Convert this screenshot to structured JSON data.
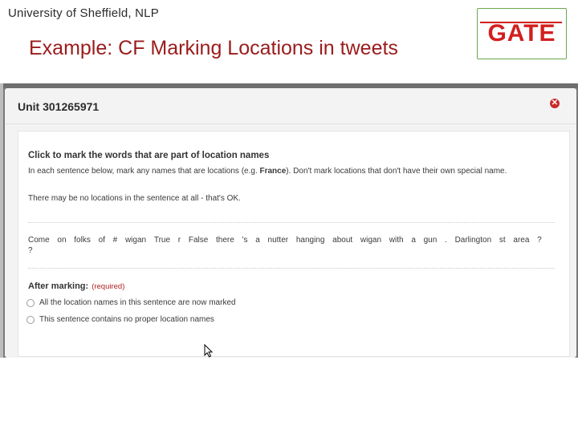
{
  "slide": {
    "organization": "University of Sheffield, NLP",
    "title": "Example: CF Marking Locations in tweets",
    "logo_text": "GATE",
    "brand_color": "#d21f1f",
    "title_color": "#9b1b1b"
  },
  "modal": {
    "title": "Unit 301265971",
    "close_icon": "close-icon"
  },
  "task": {
    "heading": "Click to mark the words that are part of location names",
    "instruction_pre": "In each sentence below, mark any names that are locations (e.g. ",
    "instruction_bold": "France",
    "instruction_post": "). Don't mark locations that don't have their own special name.",
    "note": "There may be no locations in the sentence at all - that's OK.",
    "tweet_tokens": [
      "Come",
      "on",
      "folks",
      "of",
      "#",
      "wigan",
      "True",
      "r",
      "False",
      "there",
      "'s",
      "a",
      "nutter",
      "hanging",
      "about",
      "wigan",
      "with",
      "a",
      "gun",
      ".",
      "Darlington",
      "st",
      "area",
      "?",
      "?"
    ],
    "after_label": "After marking:",
    "required_label": "(required)",
    "options": [
      "All the location names in this sentence are now marked",
      "This sentence contains no proper location names"
    ]
  }
}
